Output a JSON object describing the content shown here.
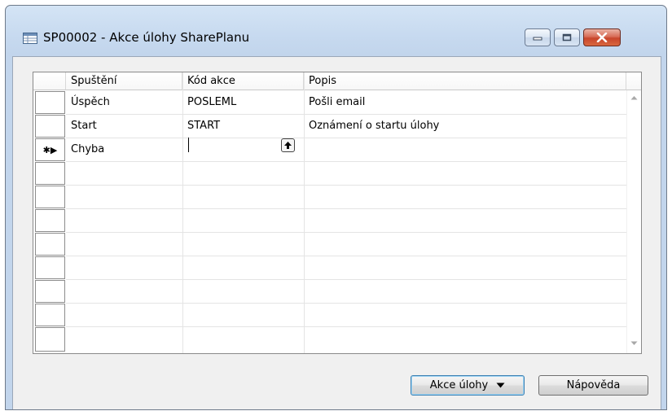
{
  "window": {
    "title": "SP00002 - Akce úlohy SharePlanu"
  },
  "grid": {
    "columns": [
      "Spuštění",
      "Kód akce",
      "Popis"
    ],
    "rows": [
      {
        "spusteni": "Úspěch",
        "kod": "POSLEML",
        "popis": "Pošli email"
      },
      {
        "spusteni": "Start",
        "kod": "START",
        "popis": "Oznámení o startu úlohy"
      },
      {
        "spusteni": "Chyba",
        "kod": "",
        "popis": ""
      }
    ],
    "current_row_marker": "✱▶"
  },
  "buttons": {
    "akce_ulohy": "Akce úlohy",
    "napoveda": "Nápověda"
  },
  "icons": {
    "window": "table-icon",
    "minimize": "minimize-icon",
    "maximize": "maximize-icon",
    "close": "close-icon",
    "lookup": "up-arrow-icon",
    "dropdown": "dropdown-triangle-icon",
    "scroll_up": "scroll-up-icon",
    "scroll_down": "scroll-down-icon"
  }
}
